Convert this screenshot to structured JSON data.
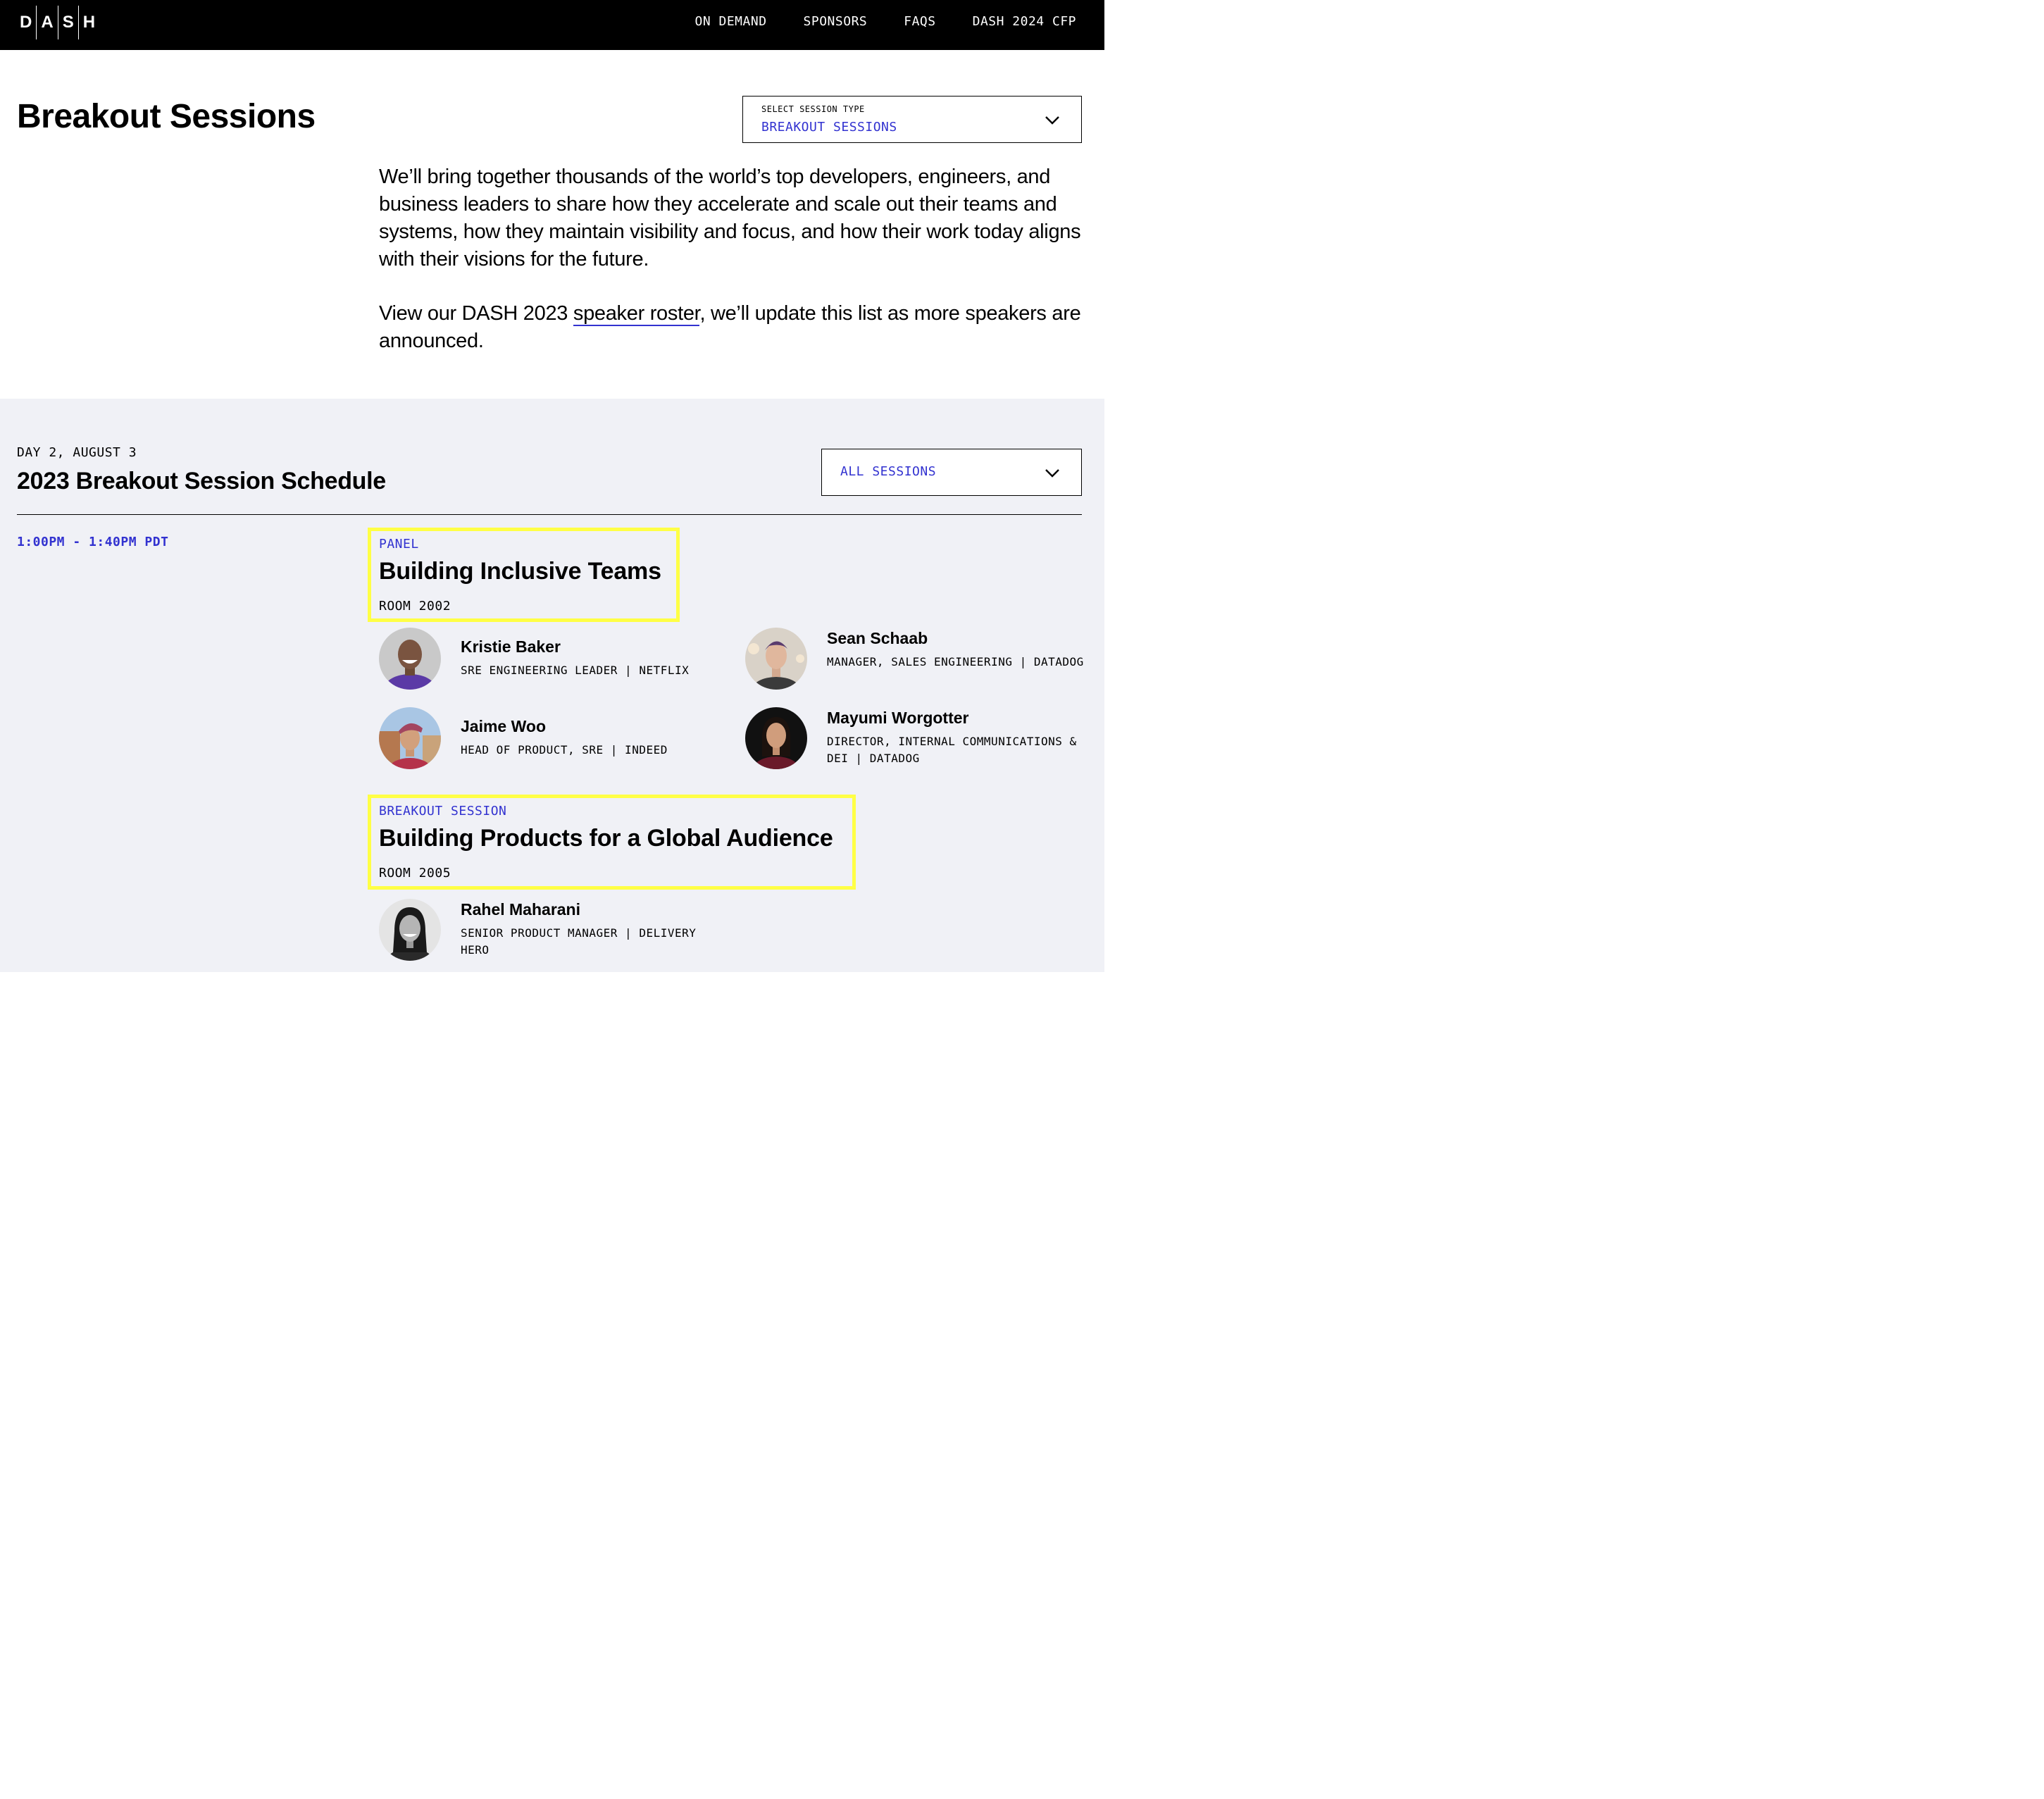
{
  "nav": {
    "logo_letters": [
      "D",
      "A",
      "S",
      "H"
    ],
    "links": [
      "ON DEMAND",
      "SPONSORS",
      "FAQS",
      "DASH 2024 CFP"
    ]
  },
  "header": {
    "title": "Breakout Sessions",
    "session_type_select": {
      "label": "SELECT SESSION TYPE",
      "value": "BREAKOUT SESSIONS"
    },
    "intro_paragraph": "We’ll bring together thousands of the world’s top developers, engineers, and business leaders to share how they accelerate and scale out their teams and systems, how they maintain visibility and focus, and how their work today aligns with their visions for the future.",
    "roster_before": "View our DASH 2023 ",
    "roster_link": "speaker roster",
    "roster_after": ", we’ll update this list as more speakers are announced."
  },
  "schedule": {
    "day_label": "DAY 2, AUGUST 3",
    "title": "2023 Breakout Session Schedule",
    "filter_value": "ALL SESSIONS",
    "time_slot": "1:00PM - 1:40PM PDT",
    "sessions": [
      {
        "type": "PANEL",
        "title": "Building Inclusive Teams",
        "room": "ROOM 2002",
        "speakers": [
          {
            "name": "Kristie Baker",
            "role": "SRE ENGINEERING LEADER | NETFLIX"
          },
          {
            "name": "Sean Schaab",
            "role": "MANAGER, SALES ENGINEERING | DATADOG"
          },
          {
            "name": "Jaime Woo",
            "role": "HEAD OF PRODUCT, SRE | INDEED"
          },
          {
            "name": "Mayumi Worgotter",
            "role": "DIRECTOR, INTERNAL COMMUNICATIONS & DEI | DATADOG"
          }
        ]
      },
      {
        "type": "BREAKOUT SESSION",
        "title": "Building Products for a Global Audience",
        "room": "ROOM 2005",
        "speakers": [
          {
            "name": "Rahel Maharani",
            "role": "SENIOR PRODUCT MANAGER | DELIVERY HERO"
          }
        ]
      }
    ]
  },
  "colors": {
    "accent_blue": "#3232d0",
    "highlight_yellow": "#ffff45",
    "section_bg": "#f0f1f6"
  }
}
